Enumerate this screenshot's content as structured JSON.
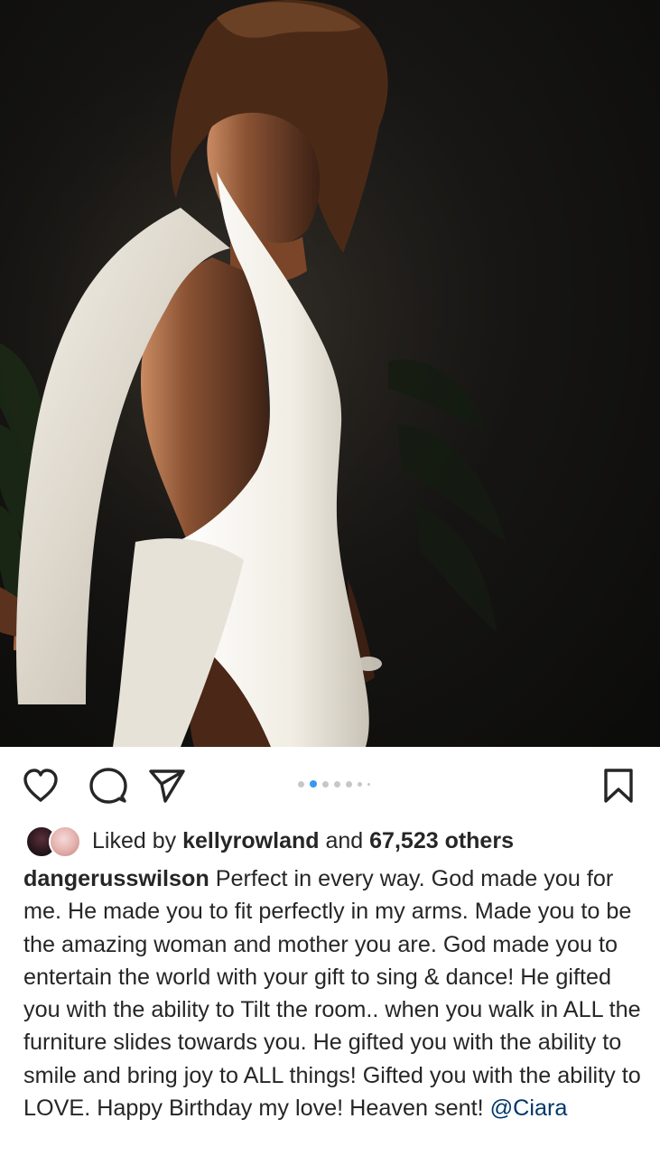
{
  "post": {
    "photo": {
      "description_icon": "photo",
      "colors": {
        "background": "#111110",
        "dress": "#f2efe8",
        "skin": "#6b3f28"
      }
    },
    "carousel": {
      "total": 7,
      "active_index": 1
    },
    "actions": {
      "like_icon": "heart-icon",
      "comment_icon": "comment-icon",
      "share_icon": "paper-plane-icon",
      "save_icon": "bookmark-icon"
    },
    "likes": {
      "prefix": "Liked by",
      "user": "kellyrowland",
      "joiner": "and",
      "count": "67,523 others"
    },
    "caption": {
      "username": "dangerusswilson",
      "text": "Perfect in every way. God made you for me. He made you to fit perfectly in my arms. Made you to be the amazing woman and mother you are. God made you to entertain the world with your gift to sing & dance! He gifted you with the ability to Tilt the room.. when you walk in ALL the furniture slides towards you. He gifted you with the ability to smile and bring joy to ALL things! Gifted you with the ability to LOVE. Happy Birthday my love! Heaven sent!",
      "mention": "@Ciara"
    },
    "colors": {
      "text": "#262626",
      "mention": "#00376b",
      "active_dot": "#3897f0",
      "inactive_dot": "#c7c7c7"
    }
  }
}
